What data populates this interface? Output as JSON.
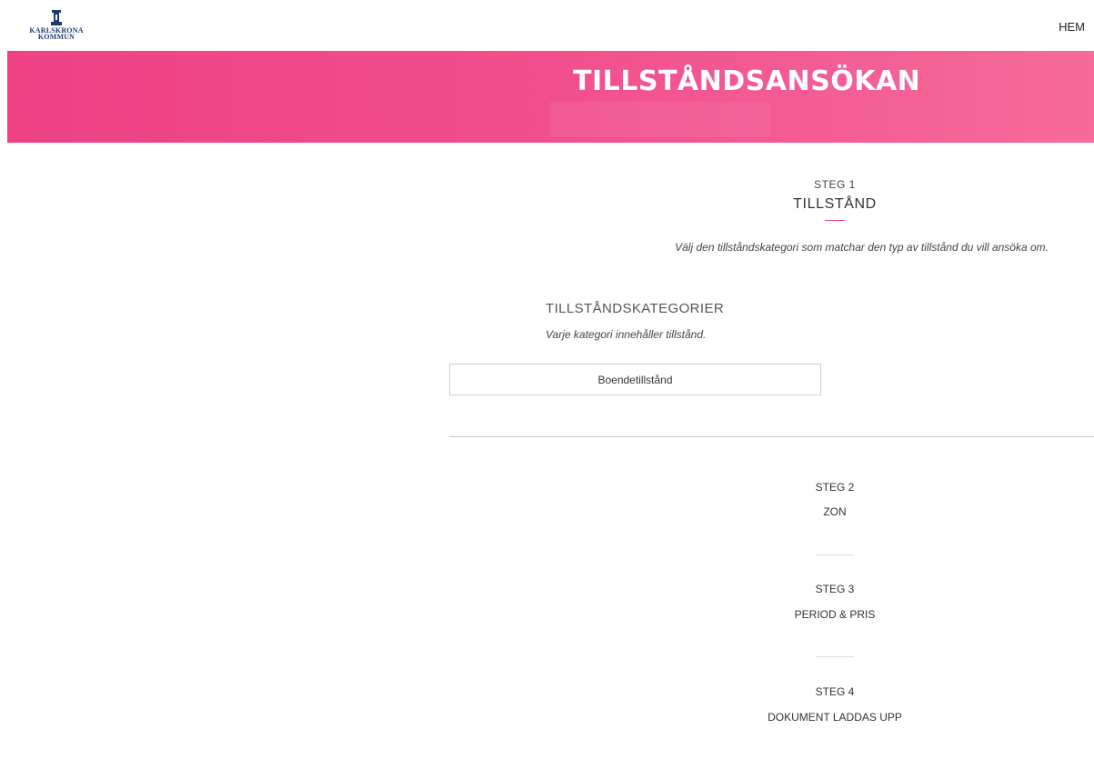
{
  "header": {
    "logo": {
      "line1": "KARLSKRONA",
      "line2": "KOMMUN"
    },
    "nav": {
      "home_label": "HEM"
    }
  },
  "banner": {
    "title": "TILLSTÅNDSANSÖKAN",
    "gradient_start": "#ee4185",
    "gradient_end": "#f66b9a"
  },
  "step1": {
    "label": "STEG 1",
    "title": "TILLSTÅND",
    "instruction": "Välj den tillståndskategori som matchar den typ av tillstånd du vill ansöka om.",
    "accent_color": "#e84a86"
  },
  "categories": {
    "heading": "TILLSTÅNDSKATEGORIER",
    "subheading": "Varje kategori innehåller tillstånd.",
    "items": [
      {
        "label": "Boendetillstånd"
      }
    ]
  },
  "steps": [
    {
      "label": "STEG 2",
      "title": "ZON"
    },
    {
      "label": "STEG 3",
      "title": "PERIOD & PRIS"
    },
    {
      "label": "STEG 4",
      "title": "DOKUMENT LADDAS UPP"
    }
  ]
}
